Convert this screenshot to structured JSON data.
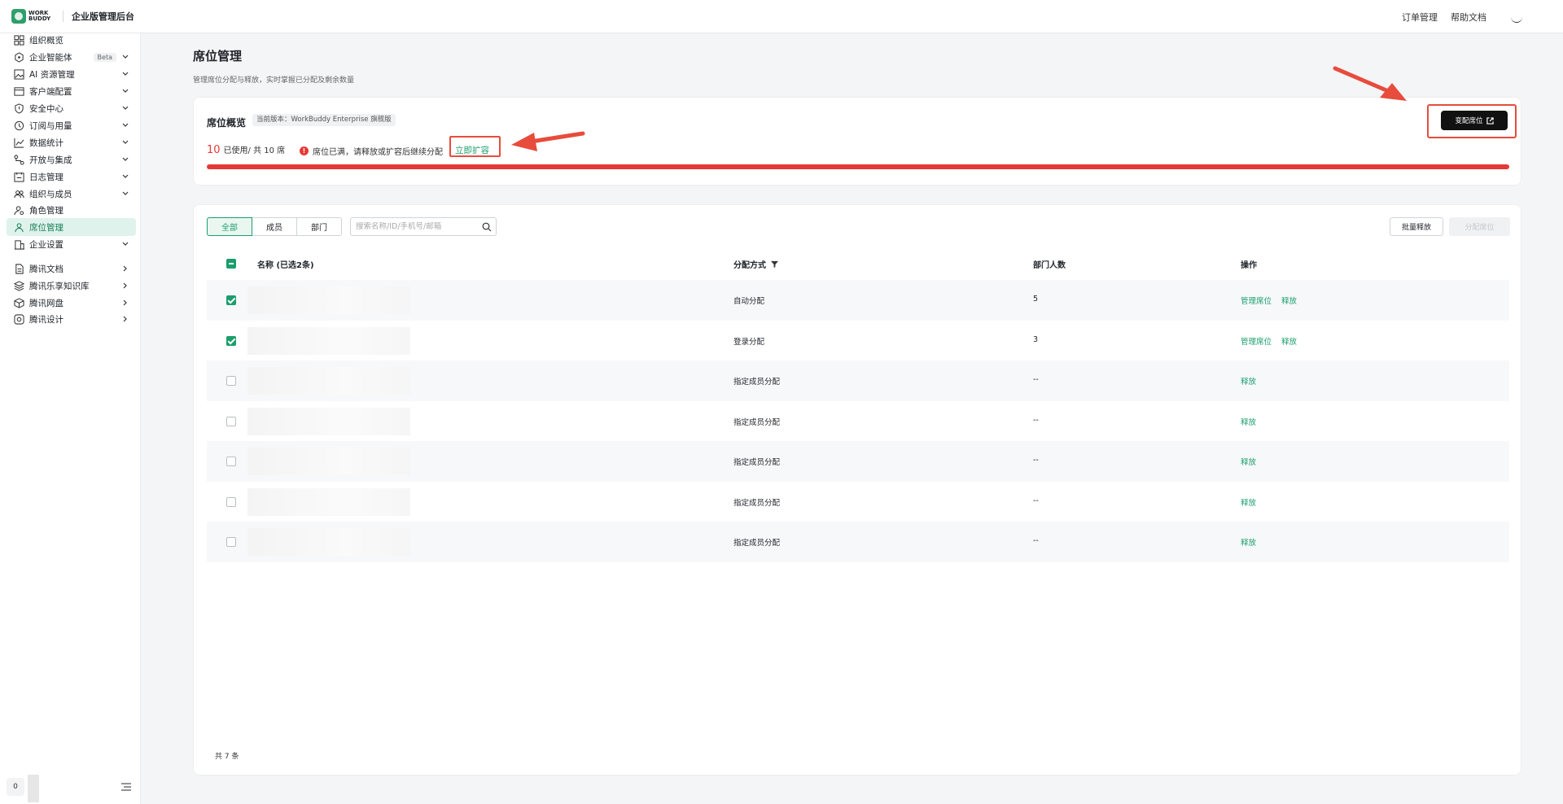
{
  "topbar": {
    "logo_text": "WORK BUDDY",
    "title": "企业版管理后台",
    "links": [
      "订单管理",
      "帮助文档"
    ]
  },
  "sidebar": {
    "items": [
      {
        "label": "组织概览",
        "icon": "grid-icon",
        "chevron": ""
      },
      {
        "label": "企业智能体",
        "icon": "hexagon-icon",
        "badge": "Beta",
        "chevron": "down"
      },
      {
        "label": "AI 资源管理",
        "icon": "image-icon",
        "chevron": "down"
      },
      {
        "label": "客户端配置",
        "icon": "window-icon",
        "chevron": "down"
      },
      {
        "label": "安全中心",
        "icon": "shield-icon",
        "chevron": "down"
      },
      {
        "label": "订阅与用量",
        "icon": "clock-icon",
        "chevron": "down"
      },
      {
        "label": "数据统计",
        "icon": "chart-icon",
        "chevron": "down"
      },
      {
        "label": "开放与集成",
        "icon": "flow-icon",
        "chevron": "down"
      },
      {
        "label": "日志管理",
        "icon": "calendar-icon",
        "chevron": "down"
      },
      {
        "label": "组织与成员",
        "icon": "group-icon",
        "chevron": "down"
      },
      {
        "label": "角色管理",
        "icon": "user-key-icon",
        "chevron": ""
      },
      {
        "label": "席位管理",
        "icon": "seat-icon",
        "chevron": "",
        "active": true
      },
      {
        "label": "企业设置",
        "icon": "building-icon",
        "chevron": "down"
      },
      {
        "label": "腾讯文档",
        "icon": "doc-icon",
        "chevron": "right"
      },
      {
        "label": "腾讯乐享知识库",
        "icon": "layers-icon",
        "chevron": "right"
      },
      {
        "label": "腾讯网盘",
        "icon": "cube-icon",
        "chevron": "right"
      },
      {
        "label": "腾讯设计",
        "icon": "design-icon",
        "chevron": "right"
      }
    ],
    "footer_avatar": "0"
  },
  "page": {
    "title": "席位管理",
    "description": "管理席位分配与释放，实时掌握已分配及剩余数量"
  },
  "overview": {
    "title": "席位概览",
    "version_tag": "当前版本：WorkBuddy Enterprise 旗舰版",
    "used": "10",
    "usage_text": "已使用/ 共 10 席",
    "warning": "席位已满，请释放或扩容后继续分配",
    "expand_link": "立即扩容",
    "allocate_button": "变配席位",
    "progress": 1.0,
    "accent_color": "#e53935"
  },
  "filters": {
    "tabs": [
      "全部",
      "成员",
      "部门"
    ],
    "active_tab": 0,
    "search_placeholder": "搜索名称/ID/手机号/邮箱",
    "bulk_release": "批量释放",
    "assign_seat": "分配席位"
  },
  "table": {
    "headers": {
      "name": "名称 (已选2条)",
      "method": "分配方式",
      "dept_count": "部门人数",
      "actions": "操作"
    },
    "rows": [
      {
        "checked": true,
        "method": "自动分配",
        "dept_count": "5",
        "actions": [
          "管理席位",
          "释放"
        ]
      },
      {
        "checked": true,
        "method": "登录分配",
        "dept_count": "3",
        "actions": [
          "管理席位",
          "释放"
        ]
      },
      {
        "checked": false,
        "method": "指定成员分配",
        "dept_count": "--",
        "actions": [
          "释放"
        ]
      },
      {
        "checked": false,
        "method": "指定成员分配",
        "dept_count": "--",
        "actions": [
          "释放"
        ]
      },
      {
        "checked": false,
        "method": "指定成员分配",
        "dept_count": "--",
        "actions": [
          "释放"
        ]
      },
      {
        "checked": false,
        "method": "指定成员分配",
        "dept_count": "--",
        "actions": [
          "释放"
        ]
      },
      {
        "checked": false,
        "method": "指定成员分配",
        "dept_count": "--",
        "actions": [
          "释放"
        ]
      }
    ],
    "total": "共 7 条"
  }
}
